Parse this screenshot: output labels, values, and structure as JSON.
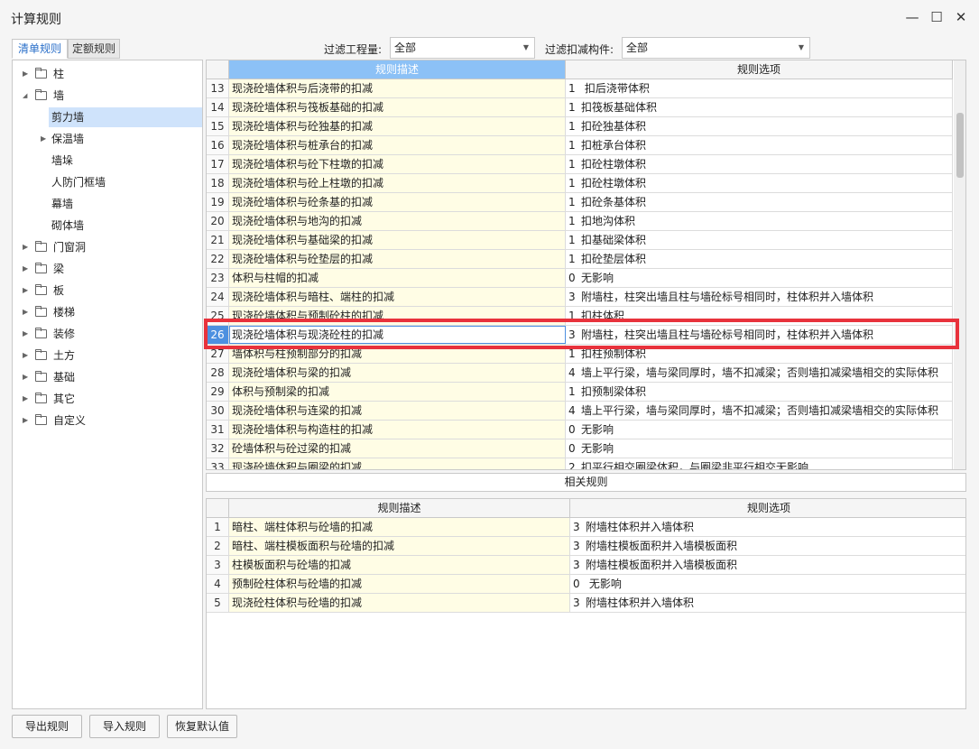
{
  "window": {
    "title": "计算规则",
    "minimize": "—",
    "maximize": "☐",
    "close": "✕"
  },
  "tabs": [
    {
      "label": "清单规则",
      "active": true
    },
    {
      "label": "定额规则",
      "active": false
    }
  ],
  "filters": {
    "quantity_label": "过滤工程量:",
    "quantity_value": "全部",
    "deduct_label": "过滤扣减构件:",
    "deduct_value": "全部"
  },
  "tree": [
    {
      "label": "柱",
      "level": 0,
      "arrow": "right",
      "folder": true
    },
    {
      "label": "墙",
      "level": 0,
      "arrow": "down",
      "folder": true
    },
    {
      "label": "剪力墙",
      "level": 1,
      "selected": true
    },
    {
      "label": "保温墙",
      "level": 1,
      "arrow": "right"
    },
    {
      "label": "墙垛",
      "level": 1
    },
    {
      "label": "人防门框墙",
      "level": 1
    },
    {
      "label": "幕墙",
      "level": 1
    },
    {
      "label": "砌体墙",
      "level": 1
    },
    {
      "label": "门窗洞",
      "level": 0,
      "arrow": "right",
      "folder": true
    },
    {
      "label": "梁",
      "level": 0,
      "arrow": "right",
      "folder": true
    },
    {
      "label": "板",
      "level": 0,
      "arrow": "right",
      "folder": true
    },
    {
      "label": "楼梯",
      "level": 0,
      "arrow": "right",
      "folder": true
    },
    {
      "label": "装修",
      "level": 0,
      "arrow": "right",
      "folder": true
    },
    {
      "label": "土方",
      "level": 0,
      "arrow": "right",
      "folder": true
    },
    {
      "label": "基础",
      "level": 0,
      "arrow": "right",
      "folder": true
    },
    {
      "label": "其它",
      "level": 0,
      "arrow": "right",
      "folder": true
    },
    {
      "label": "自定义",
      "level": 0,
      "arrow": "right",
      "folder": true
    }
  ],
  "main_table": {
    "columns": [
      "规则描述",
      "规则选项"
    ],
    "current_row": "26",
    "rows": [
      {
        "n": "13",
        "desc": "现浇砼墙体积与后浇带的扣减",
        "code": "1",
        "option": " 扣后浇带体积"
      },
      {
        "n": "14",
        "desc": "现浇砼墙体积与筏板基础的扣减",
        "code": "1",
        "option": "扣筏板基础体积"
      },
      {
        "n": "15",
        "desc": "现浇砼墙体积与砼独基的扣减",
        "code": "1",
        "option": "扣砼独基体积"
      },
      {
        "n": "16",
        "desc": "现浇砼墙体积与桩承台的扣减",
        "code": "1",
        "option": "扣桩承台体积"
      },
      {
        "n": "17",
        "desc": "现浇砼墙体积与砼下柱墩的扣减",
        "code": "1",
        "option": "扣砼柱墩体积"
      },
      {
        "n": "18",
        "desc": "现浇砼墙体积与砼上柱墩的扣减",
        "code": "1",
        "option": "扣砼柱墩体积"
      },
      {
        "n": "19",
        "desc": "现浇砼墙体积与砼条基的扣减",
        "code": "1",
        "option": "扣砼条基体积"
      },
      {
        "n": "20",
        "desc": "现浇砼墙体积与地沟的扣减",
        "code": "1",
        "option": "扣地沟体积"
      },
      {
        "n": "21",
        "desc": "现浇砼墙体积与基础梁的扣减",
        "code": "1",
        "option": "扣基础梁体积"
      },
      {
        "n": "22",
        "desc": "现浇砼墙体积与砼垫层的扣减",
        "code": "1",
        "option": "扣砼垫层体积"
      },
      {
        "n": "23",
        "desc": "体积与柱帽的扣减",
        "code": "0",
        "option": "无影响"
      },
      {
        "n": "24",
        "desc": "现浇砼墙体积与暗柱、端柱的扣减",
        "code": "3",
        "option": "附墙柱，柱突出墙且柱与墙砼标号相同时，柱体积并入墙体积"
      },
      {
        "n": "25",
        "desc": "现浇砼墙体积与预制砼柱的扣减",
        "code": "1",
        "option": "扣柱体积"
      },
      {
        "n": "26",
        "desc": "现浇砼墙体积与现浇砼柱的扣减",
        "code": "3",
        "option": "附墙柱，柱突出墙且柱与墙砼标号相同时，柱体积并入墙体积"
      },
      {
        "n": "27",
        "desc": "墙体积与柱预制部分的扣减",
        "code": "1",
        "option": "扣柱预制体积"
      },
      {
        "n": "28",
        "desc": "现浇砼墙体积与梁的扣减",
        "code": "4",
        "option": "墙上平行梁，墙与梁同厚时，墙不扣减梁；否则墙扣减梁墙相交的实际体积"
      },
      {
        "n": "29",
        "desc": "体积与预制梁的扣减",
        "code": "1",
        "option": "扣预制梁体积"
      },
      {
        "n": "30",
        "desc": "现浇砼墙体积与连梁的扣减",
        "code": "4",
        "option": "墙上平行梁，墙与梁同厚时，墙不扣减梁；否则墙扣减梁墙相交的实际体积"
      },
      {
        "n": "31",
        "desc": "现浇砼墙体积与构造柱的扣减",
        "code": "0",
        "option": "无影响"
      },
      {
        "n": "32",
        "desc": "砼墙体积与砼过梁的扣减",
        "code": "0",
        "option": "无影响"
      },
      {
        "n": "33",
        "desc": "现浇砼墙体积与圈梁的扣减",
        "code": "2",
        "option": "扣平行相交圈梁体积，与圈梁非平行相交无影响"
      }
    ]
  },
  "related": {
    "title": "相关规则",
    "columns": [
      "规则描述",
      "规则选项"
    ],
    "rows": [
      {
        "n": "1",
        "desc": "暗柱、端柱体积与砼墙的扣减",
        "code": "3",
        "option": "附墙柱体积并入墙体积"
      },
      {
        "n": "2",
        "desc": "暗柱、端柱模板面积与砼墙的扣减",
        "code": "3",
        "option": "附墙柱模板面积并入墙模板面积"
      },
      {
        "n": "3",
        "desc": "柱模板面积与砼墙的扣减",
        "code": "3",
        "option": "附墙柱模板面积并入墙模板面积"
      },
      {
        "n": "4",
        "desc": "预制砼柱体积与砼墙的扣减",
        "code": "0",
        "option": " 无影响"
      },
      {
        "n": "5",
        "desc": "现浇砼柱体积与砼墙的扣减",
        "code": "3",
        "option": "附墙柱体积并入墙体积"
      }
    ]
  },
  "buttons": {
    "export": "导出规则",
    "import": "导入规则",
    "restore": "恢复默认值"
  }
}
